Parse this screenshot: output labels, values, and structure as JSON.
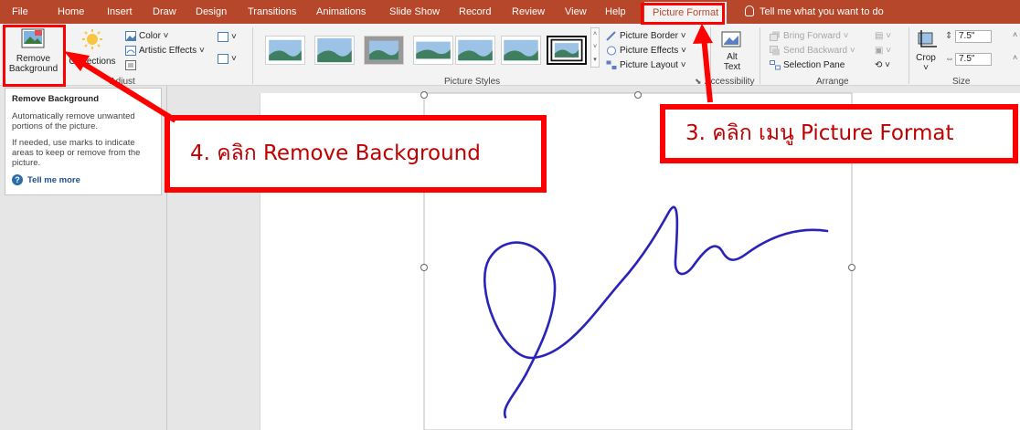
{
  "ribbon_tabs": [
    "File",
    "Home",
    "Insert",
    "Draw",
    "Design",
    "Transitions",
    "Animations",
    "Slide Show",
    "Record",
    "Review",
    "View",
    "Help",
    "Picture Format"
  ],
  "active_tab": "Picture Format",
  "tell_me": "Tell me what you want to do",
  "adjust": {
    "remove_bg_line1": "Remove",
    "remove_bg_line2": "Background",
    "corrections": "Corrections",
    "color": "Color",
    "artistic_effects": "Artistic Effects",
    "group_label": "Adjust"
  },
  "picture_styles": {
    "group_label": "Picture Styles",
    "picture_border": "Picture Border",
    "picture_effects": "Picture Effects",
    "picture_layout": "Picture Layout"
  },
  "accessibility": {
    "alt_line1": "Alt",
    "alt_line2": "Text",
    "group_label": "Accessibility"
  },
  "arrange": {
    "bring_forward": "Bring Forward",
    "send_backward": "Send Backward",
    "selection_pane": "Selection Pane",
    "group_label": "Arrange"
  },
  "size": {
    "crop": "Crop",
    "height": "7.5\"",
    "width": "7.5\"",
    "group_label": "Size"
  },
  "tooltip": {
    "title": "Remove Background",
    "para1": "Automatically remove unwanted portions of the picture.",
    "para2": "If needed, use marks to indicate areas to keep or remove from the picture.",
    "tell_me_more": "Tell me more"
  },
  "callouts": {
    "step3": "3. คลิก เมนู Picture Format",
    "step4": "4. คลิก Remove Background"
  },
  "colors": {
    "accent": "#b7472a",
    "annotation": "#ff0000",
    "signature_ink": "#2a23b8"
  }
}
